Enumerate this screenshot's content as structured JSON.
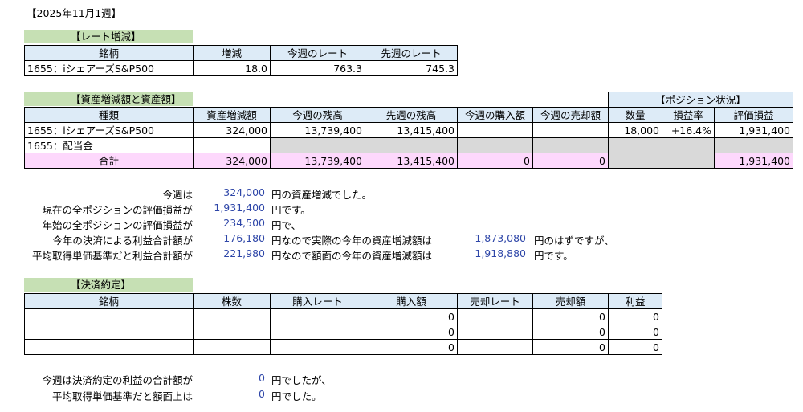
{
  "title": "【2025年11月1週】",
  "rate": {
    "section": "【レート増減】",
    "headers": [
      "銘柄",
      "増減",
      "今週のレート",
      "先週のレート"
    ],
    "row": [
      "1655：iシェアーズS&P500",
      "18.0",
      "763.3",
      "745.3"
    ]
  },
  "assets": {
    "section": "【資産増減額と資産額】",
    "position_header": "【ポジション状況】",
    "headers": [
      "種類",
      "資産増減額",
      "今週の残高",
      "先週の残高",
      "今週の購入額",
      "今週の売却額",
      "数量",
      "損益率",
      "評価損益"
    ],
    "rows": [
      [
        "1655：iシェアーズS&P500",
        "324,000",
        "13,739,400",
        "13,415,400",
        "",
        "",
        "18,000",
        "+16.4%",
        "1,931,400"
      ],
      [
        "1655：配当金",
        "",
        "",
        "",
        "",
        "",
        "",
        "",
        ""
      ],
      [
        "合計",
        "324,000",
        "13,739,400",
        "13,415,400",
        "0",
        "0",
        "",
        "",
        "1,931,400"
      ]
    ]
  },
  "summary": [
    {
      "label": "今週は",
      "value": "324,000",
      "text": "円の資産増減でした。"
    },
    {
      "label": "現在の全ポジションの評価損益が",
      "value": "1,931,400",
      "text": "円です。"
    },
    {
      "label": "年始の全ポジションの評価損益が",
      "value": "234,500",
      "text": "円で、"
    },
    {
      "label": "今年の決済による利益合計額が",
      "value": "176,180",
      "text": "円なので実際の今年の資産増減額は",
      "value2": "1,873,080",
      "text2": "円のはずですが、"
    },
    {
      "label": "平均取得単価基準だと利益合計額が",
      "value": "221,980",
      "text": "円なので額面の今年の資産増減額は",
      "value2": "1,918,880",
      "text2": "円です。"
    }
  ],
  "settlement": {
    "section": "【決済約定】",
    "headers": [
      "銘柄",
      "株数",
      "購入レート",
      "購入額",
      "売却レート",
      "売却額",
      "利益"
    ],
    "rows": [
      [
        "",
        "",
        "",
        "0",
        "",
        "0",
        "0"
      ],
      [
        "",
        "",
        "",
        "0",
        "",
        "0",
        "0"
      ],
      [
        "",
        "",
        "",
        "0",
        "",
        "0",
        "0"
      ]
    ]
  },
  "closing": [
    {
      "label": "今週は決済約定の利益の合計額が",
      "value": "0",
      "text": "円でしたが、"
    },
    {
      "label": "平均取得単価基準だと額面上は",
      "value": "0",
      "text": "円でした。"
    }
  ],
  "colors": {
    "section_bg": "#c6e0b4",
    "header_bg": "#ddebf7",
    "total_bg": "#fdd8fc",
    "gray": "#d9d9d9",
    "value_blue": "#2e46a8"
  }
}
